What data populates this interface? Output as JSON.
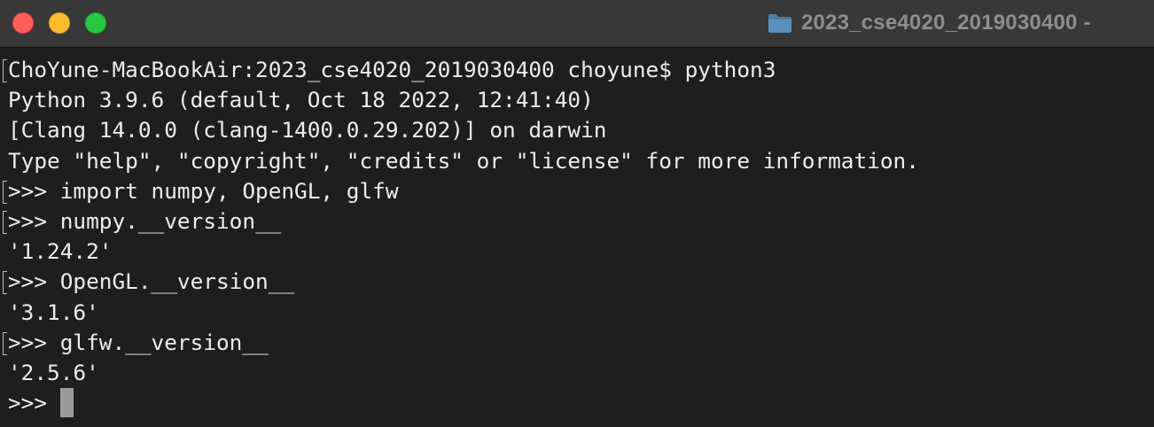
{
  "window": {
    "title": "2023_cse4020_2019030400 -",
    "title_icon": "folder-icon",
    "controls": {
      "close_icon": "close-icon",
      "minimize_icon": "minimize-icon",
      "zoom_icon": "zoom-icon"
    }
  },
  "colors": {
    "background": "#1e1e1e",
    "titlebar": "#383838",
    "text": "#ececec",
    "close": "#ff5f57",
    "minimize": "#febc2e",
    "zoom": "#28c840",
    "folder": "#4a7ea8"
  },
  "terminal": {
    "lines": [
      "ChoYune-MacBookAir:2023_cse4020_2019030400 choyune$ python3",
      "Python 3.9.6 (default, Oct 18 2022, 12:41:40)",
      "[Clang 14.0.0 (clang-1400.0.29.202)] on darwin",
      "Type \"help\", \"copyright\", \"credits\" or \"license\" for more information.",
      ">>> import numpy, OpenGL, glfw",
      ">>> numpy.__version__",
      "'1.24.2'",
      ">>> OpenGL.__version__",
      "'3.1.6'",
      ">>> glfw.__version__",
      "'2.5.6'"
    ],
    "prompt": ">>> "
  }
}
